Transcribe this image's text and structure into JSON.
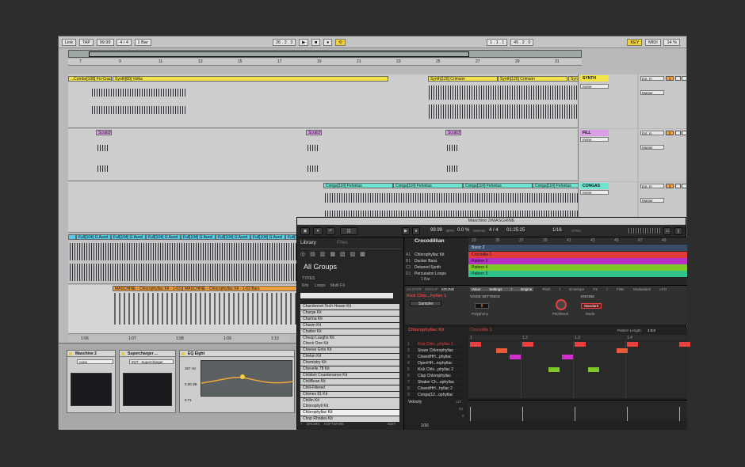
{
  "ableton": {
    "transport": {
      "link": "Link",
      "tap": "TAP",
      "tempo": "99.99",
      "meter": "4 / 4",
      "quantize": "1 Bar",
      "position": "26 . 2 . 3",
      "loop_start": "1 . 1 . 1",
      "loop_length": "45 . 2 . 0",
      "key": "KEY",
      "midi": "MIDI",
      "cpu": "14 %"
    },
    "ruler_ticks": [
      "1",
      "5",
      "9",
      "13",
      "17",
      "21",
      "25",
      "29",
      "33",
      "37"
    ],
    "ruler_ticks2": [
      "7",
      "9",
      "11",
      "13",
      "15",
      "17",
      "19",
      "21",
      "23",
      "25",
      "27",
      "29",
      "31"
    ],
    "tracks": [
      {
        "name": "SYNTH",
        "color": "#f2e34a",
        "input": "Keine",
        "out": "Master",
        "vol": "4",
        "clips": [
          "...Combo[108] Frt-Cracked",
          "Synth[80] Volka",
          "Synth[120] Crimson",
          "Synth[120] Crimson",
          "Synth[12"
        ]
      },
      {
        "name": "FILL",
        "color": "#d99ee3",
        "input": "Keine",
        "out": "Master",
        "vol": "2",
        "clips": [
          "Scratch[88]",
          "Scratch[88]",
          "Scratch[88]"
        ]
      },
      {
        "name": "CONGAS",
        "color": "#6ee3d0",
        "input": "Keine",
        "out": "Master",
        "vol": "3",
        "clips": [
          "Conga[110] Felonius",
          "Conga[110] Felonius",
          "Conga[110] Felonius",
          "Conga[110] Felonius"
        ]
      },
      {
        "name": "FULL",
        "color": "#59c9e8",
        "clips": [
          "Full[104] G Aurel",
          "Full[104] G Aurel",
          "Full[104] G Aurel",
          "Full[104] G Aurel",
          "Full[104] G Aurel",
          "Full[104] G Aurel",
          "Full[104] G Aurel"
        ]
      },
      {
        "name": "MASCHINE",
        "color": "#f29d3b",
        "clips": [
          "MASCHINE - Chlorophyllac Kit - 1-63 Bars",
          "MASCHINE - Chlorophyllac Kit - 1-63 Bars"
        ]
      }
    ],
    "mixer_labels": {
      "ext_in": "Ext. In",
      "auto": "Auto",
      "off": "Off",
      "in": "In"
    },
    "devices": [
      {
        "name": "Maschine 2",
        "preset": "none"
      },
      {
        "name": "Supercharger ...",
        "preset": "INIT - Supercharger"
      },
      {
        "name": "EQ Eight",
        "freq": "257 Hz",
        "gain": "0.00 dB",
        "q": "0.71"
      }
    ],
    "bottom_ruler": [
      "1:06",
      "1:07",
      "1:08",
      "1:09",
      "1:10"
    ]
  },
  "maschine": {
    "window_title": "Maschine 2/MASCHINE",
    "bpm": "99.99",
    "bpm_label": "BPM",
    "swing": "0.0 %",
    "swing_label": "SWING",
    "sig": "4 / 4",
    "time": "01:25:25",
    "grid": "1/16",
    "sync": "SYNC",
    "tabs": {
      "library": "Library",
      "files": "Files"
    },
    "all_groups": "All Groups",
    "types_header": "TYPES",
    "type_filters": [
      "Kits",
      "Loops",
      "Multi FX"
    ],
    "kits": [
      "Chardonnet Tech House Kit",
      "Charge Kit",
      "Charina Kit",
      "Chasm Kit",
      "Chatter Kit",
      "Cheap Laughs Kit",
      "Check One Kit",
      "Cheese Grits Kit",
      "Chelan Kit",
      "Chemistry Kit",
      "Chevelle 78 Kit",
      "Childish Countenance Kit",
      "ChiliBean Kit",
      "Chill-Filtered",
      "Chimes 81 Kit",
      "Chillin Kit",
      "Chlorophyll Kit",
      "Chlorophyllac Kit",
      "Chop Rhodes Kit"
    ],
    "selected_kit": "Chlorophyllac Kit",
    "bottom_bar": [
      "+ DRUMS",
      "SOFTWARE",
      "EDIT"
    ],
    "project": "Crocodillian",
    "bar_ticks": [
      "33",
      "35",
      "37",
      "39",
      "41",
      "43",
      "45",
      "47",
      "49"
    ],
    "scene": "Basic 2",
    "groups": [
      {
        "slot": "A1",
        "name": "Chlorophyllac Kit",
        "pattern": "Crocodile 1",
        "color": "#e23a3a"
      },
      {
        "slot": "B1",
        "name": "Ducker Bass",
        "pattern": "Pattern 3",
        "color": "#b332c4"
      },
      {
        "slot": "C1",
        "name": "Detuned Synth",
        "pattern": "Pattern 4",
        "color": "#7dc92a"
      },
      {
        "slot": "D1",
        "name": "Percussion Loops",
        "pattern": "Pattern 3",
        "color": "#2fc48a"
      }
    ],
    "bar_label": "1 Bar",
    "sound_tabs": [
      "MASTER",
      "GROUP",
      "SOUND"
    ],
    "kick_name": "Kick Chlo...hyllac 1",
    "plugin_tabs": [
      "Voice Settings / Engine",
      "Pitch / Envelope",
      "FX / Filter",
      "Modulation",
      "LFO"
    ],
    "voice_settings": "VOICE SETTINGS",
    "engine": "ENGINE",
    "sampler": "Sampler",
    "polyphony_label": "Polyphony",
    "polyphony_value": "8",
    "pitchbend_label": "Pitchbend",
    "mode_label": "Mode",
    "mode_value": "Standard",
    "pattern_group": "Chlorophyllac Kit",
    "pattern_name": "Crocodile 1",
    "pattern_length_label": "Pattern Length:",
    "pattern_length": "4:0:0",
    "beat_ticks": [
      "1",
      "1.2",
      "1.3",
      "1.4"
    ],
    "sounds": [
      "Kick Chlo...phyllac 1",
      "Snare Chlorophyllac",
      "ClosedHH...phyllac",
      "OpenHH...rophyllac",
      "Kick Chlo...phyllac 2",
      "Clap Chlorophyllac",
      "Shaker Ch...ophyllac",
      "ClosedHH...hyllac 2",
      "Conga(12...ophyllac"
    ],
    "velocity_label": "Velocity",
    "velocity_ticks": [
      "127",
      "63",
      "0"
    ],
    "footer_grid": "1/16"
  }
}
